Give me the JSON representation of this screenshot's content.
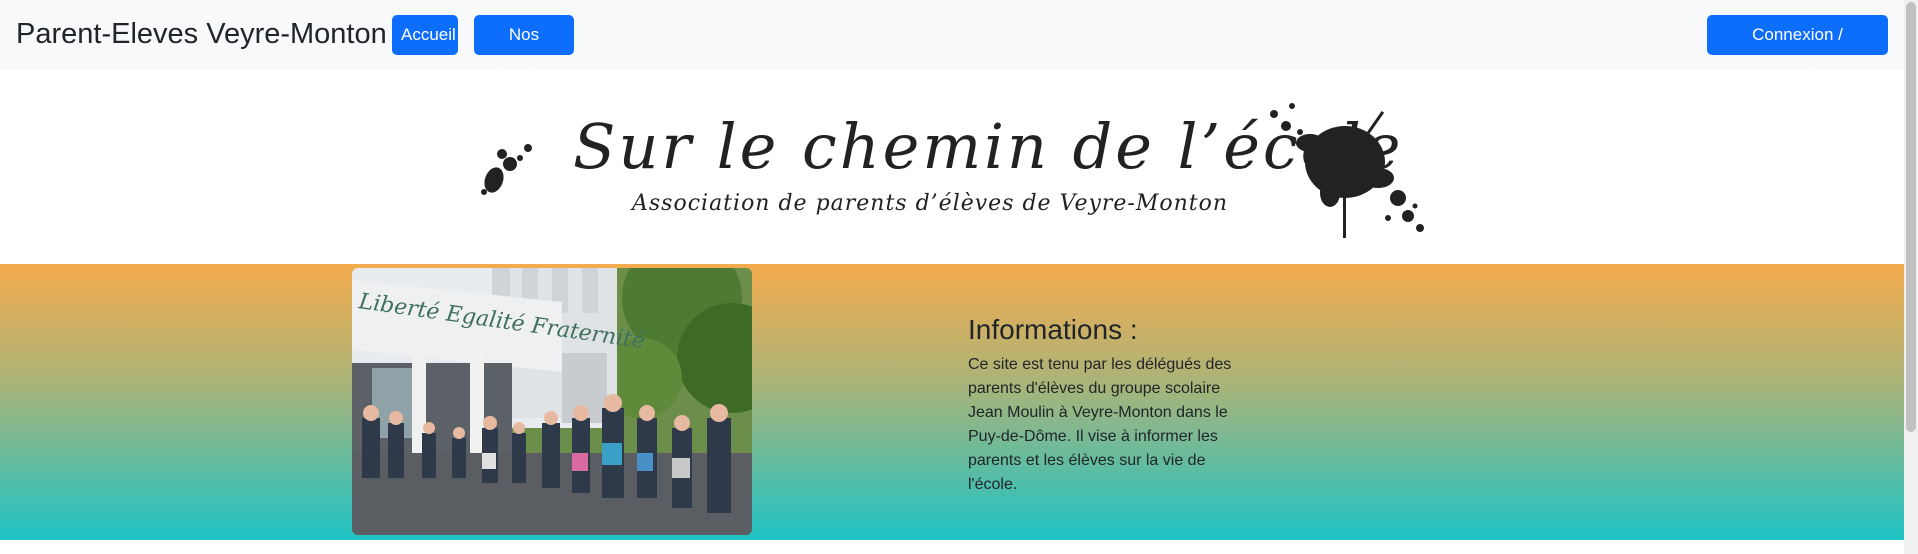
{
  "navbar": {
    "brand": "Parent-Eleves Veyre-Monton",
    "home_label": "Accueil",
    "articles_label": "Nos Articles",
    "login_label": "Connexion / Inscription"
  },
  "banner": {
    "title": "Sur le chemin de l’école",
    "subtitle": "Association de parents d’élèves de Veyre-Monton"
  },
  "photo": {
    "sign_text": "Liberté Egalité Fraternité"
  },
  "info": {
    "title": "Informations :",
    "text": "Ce site est tenu par les délégués des parents d'élèves du groupe scolaire Jean Moulin à Veyre-Monton dans le Puy-de-Dôme. Il vise à informer les parents et les élèves sur la vie de l'école."
  },
  "colors": {
    "primary": "#0d6efd",
    "gradient_top": "#f4ab4e",
    "gradient_bottom": "#1ec3c6"
  }
}
